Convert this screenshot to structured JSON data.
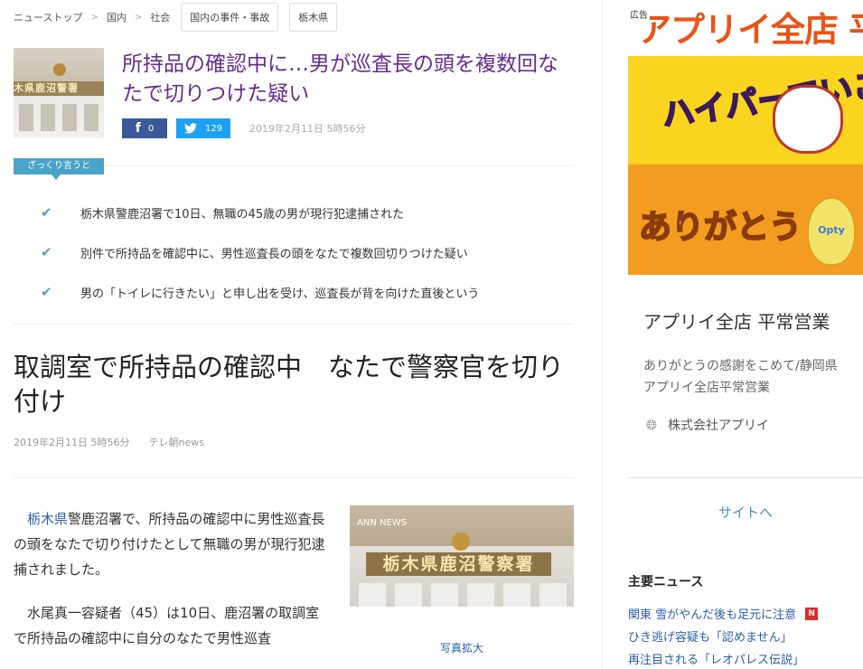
{
  "breadcrumb": {
    "items": [
      "ニューストップ",
      "国内",
      "社会"
    ],
    "tags": [
      "国内の事件・事故",
      "栃木県"
    ]
  },
  "article": {
    "headline": "所持品の確認中に…男が巡査長の頭を複数回なたで切りつけた疑い",
    "thumb_text": "木県鹿沼警署",
    "share": {
      "facebook_count": "0",
      "twitter_count": "129"
    },
    "date": "2019年2月11日 5時56分",
    "summary_label": "ざっくり言うと",
    "summary_points": [
      "栃木県警鹿沼署で10日、無職の45歳の男が現行犯逮捕された",
      "別件で所持品を確認中に、男性巡査長の頭をなたで複数回切りつけた疑い",
      "男の「トイレに行きたい」と申し出を受け、巡査長が背を向けた直後という"
    ],
    "title": "取調室で所持品の確認中　なたで警察官を切り付け",
    "meta_date": "2019年2月11日 5時56分",
    "source": "テレ朝news",
    "body": {
      "p1_link": "栃木県",
      "p1_rest": "警鹿沼署で、所持品の確認中に男性巡査長の頭をなたで切り付けたとして無職の男が現行犯逮捕されました。",
      "p2": "水尾真一容疑者（45）は10日、鹿沼署の取調室で所持品の確認中に自分のなたで男性巡査"
    },
    "photo": {
      "sign": "栃木県鹿沼警察署",
      "logo": "ANN NEWS",
      "caption": "写真拡大"
    }
  },
  "sidebar": {
    "ad_label": "広告",
    "ad_title": "アプリイ全店 平常営",
    "ad_image_text": {
      "top": "ハイパーでいこう!",
      "bottom": "ありがとう",
      "egg": "Opty"
    },
    "ad_name": "アプリイ全店 平常営業",
    "ad_desc": [
      "ありがとうの感謝をこめて/静岡県",
      "アプリイ全店平常営業"
    ],
    "ad_company": "株式会社アプリイ",
    "ad_link": "サイトへ",
    "news_heading": "主要ニュース",
    "news": [
      {
        "title": "関東 雪がやんだ後も足元に注意",
        "badge": "N"
      },
      {
        "title": "ひき逃げ容疑も「認めません」",
        "badge": ""
      },
      {
        "title": "再注目される「レオパレス伝説」",
        "badge": ""
      }
    ]
  },
  "colors": {
    "headline": "#662d91",
    "accent": "#4aa3c8",
    "link": "#2a5ea8",
    "ad_title": "#e8541a"
  }
}
